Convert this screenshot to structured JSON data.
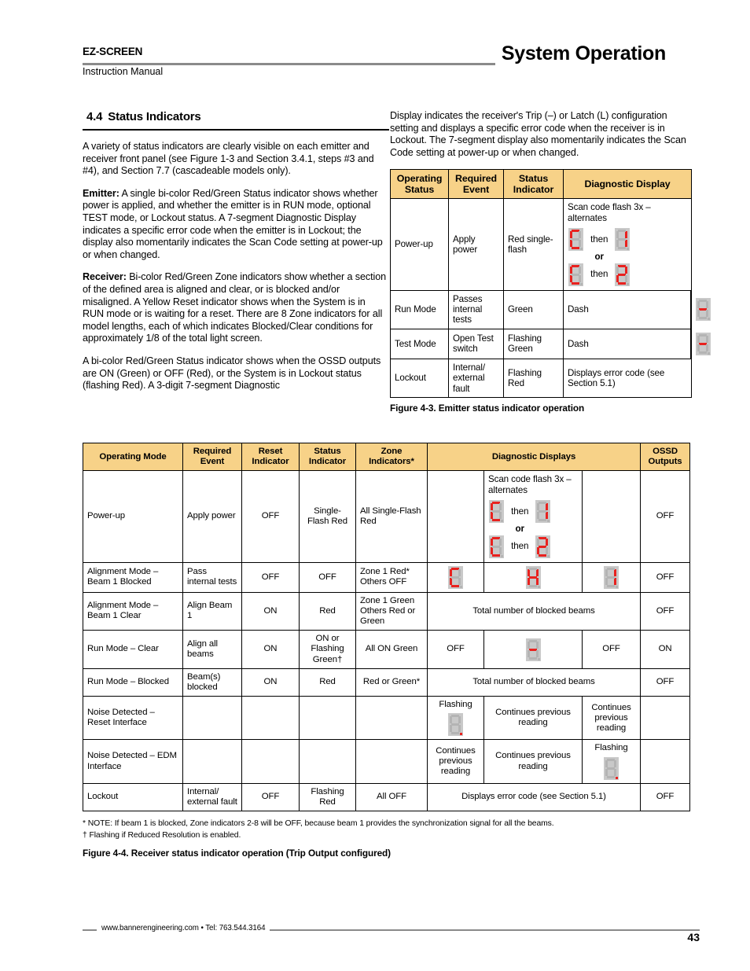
{
  "header": {
    "brand": "EZ-SCREEN",
    "subtitle": "Instruction Manual",
    "title": "System Operation"
  },
  "section": {
    "number": "4.4",
    "title": "Status Indicators"
  },
  "left_column": {
    "p1": "A variety of status indicators are clearly visible on each emitter and receiver front panel (see Figure 1-3 and Section 3.4.1, steps #3 and #4), and Section 7.7 (cascadeable models only).",
    "p2_label": "Emitter:",
    "p2": " A single bi-color Red/Green Status indicator shows whether power is applied, and whether the emitter is in RUN mode, optional TEST mode, or Lockout status. A 7-segment Diagnostic Display indicates a specific error code when the emitter is in Lockout; the display also momentarily indicates the Scan Code setting at power-up or when changed.",
    "p3_label": "Receiver:",
    "p3": " Bi-color Red/Green Zone indicators show whether a section of the defined area is aligned and clear, or is blocked and/or misaligned. A Yellow Reset indicator shows when the System is in RUN mode or is waiting for a reset. There are 8 Zone indicators for all model lengths, each of which indicates Blocked/Clear conditions for approximately 1/8 of the total light screen.",
    "p4": "A bi-color Red/Green Status indicator shows when the OSSD outputs are ON (Green) or OFF (Red), or the System is in Lockout status (flashing Red). A 3-digit 7-segment Diagnostic"
  },
  "right_column": {
    "p1": "Display indicates the receiver's Trip (–) or Latch (L) configuration setting and displays a specific error code when the receiver is in Lockout. The 7-segment display also momentarily indicates the Scan Code setting at power-up or when changed."
  },
  "emitter_table": {
    "headers": [
      "Operating Status",
      "Required Event",
      "Status Indicator",
      "Diagnostic Display"
    ],
    "rows": [
      {
        "status": "Power-up",
        "event": "Apply power",
        "indicator": "Red single-flash",
        "diag_caption": "Scan code flash 3x – alternates",
        "diag_then": "then",
        "diag_or": "or",
        "digits": [
          "C",
          "1",
          "C",
          "2"
        ]
      },
      {
        "status": "Run Mode",
        "event": "Passes internal tests",
        "indicator": "Green",
        "diag_text": "Dash",
        "diag_digit": "dash"
      },
      {
        "status": "Test Mode",
        "event": "Open Test switch",
        "indicator": "Flashing Green",
        "diag_text": "Dash",
        "diag_digit": "dash"
      },
      {
        "status": "Lockout",
        "event": "Internal/ external fault",
        "indicator": "Flashing Red",
        "diag_text": "Displays error code (see Section 5.1)"
      }
    ],
    "caption": "Figure 4-3. Emitter status indicator operation"
  },
  "receiver_table": {
    "headers": [
      "Operating Mode",
      "Required Event",
      "Reset Indicator",
      "Status Indicator",
      "Zone Indicators*",
      "Diagnostic Displays",
      "OSSD Outputs"
    ],
    "rows": [
      {
        "mode": "Power-up",
        "event": "Apply power",
        "reset": "OFF",
        "status": "Single-Flash Red",
        "zone": "All Single-Flash Red",
        "d1": "",
        "d2_caption": "Scan code flash 3x – alternates",
        "d2_then": "then",
        "d2_or": "or",
        "d2_digits": [
          "C",
          "1",
          "C",
          "2"
        ],
        "d3": "",
        "ossd": "OFF"
      },
      {
        "mode": "Alignment Mode – Beam 1 Blocked",
        "event": "Pass internal tests",
        "reset": "OFF",
        "status": "OFF",
        "zone": "Zone 1 Red* Others OFF",
        "d1_digit": "C",
        "d2_digit": "H",
        "d3_digit": "1",
        "ossd": "OFF"
      },
      {
        "mode": "Alignment Mode – Beam 1 Clear",
        "event": "Align Beam 1",
        "reset": "ON",
        "status": "Red",
        "zone": "Zone 1 Green Others Red or Green",
        "d_span": "Total number of blocked beams",
        "ossd": "OFF"
      },
      {
        "mode": "Run Mode – Clear",
        "event": "Align all beams",
        "reset": "ON",
        "status": "ON or Flashing Green†",
        "zone": "All ON Green",
        "d1": "OFF",
        "d2_digit": "dash",
        "d3": "OFF",
        "ossd": "ON"
      },
      {
        "mode": "Run Mode – Blocked",
        "event": "Beam(s) blocked",
        "reset": "ON",
        "status": "Red",
        "zone": "Red or Green*",
        "d_span": "Total number of blocked beams",
        "ossd": "OFF"
      },
      {
        "mode": "Noise Detected – Reset Interface",
        "event": "",
        "reset": "",
        "status": "",
        "zone": "",
        "d1": "Flashing",
        "d1_digit": "blank",
        "d2": "Continues previous reading",
        "d3": "Continues previous reading",
        "ossd": ""
      },
      {
        "mode": "Noise Detected – EDM Interface",
        "event": "",
        "reset": "",
        "status": "",
        "zone": "",
        "d1": "Continues previous reading",
        "d2": "Continues previous reading",
        "d3": "Flashing",
        "d3_digit": "blank",
        "ossd": ""
      },
      {
        "mode": "Lockout",
        "event": "Internal/ external fault",
        "reset": "OFF",
        "status": "Flashing Red",
        "zone": "All OFF",
        "d_span": "Displays error code (see Section 5.1)",
        "ossd": "OFF"
      }
    ],
    "notes": [
      "* NOTE: If beam 1 is blocked, Zone indicators 2-8 will be OFF, because beam 1 provides the synchronization signal for all the beams.",
      "† Flashing if Reduced Resolution is enabled."
    ],
    "caption": "Figure 4-4. Receiver status indicator operation (Trip Output configured)"
  },
  "footer": {
    "text": "www.bannerengineering.com  •  Tel: 763.544.3164",
    "page": "43"
  },
  "colors": {
    "header_fill": "#F7D288",
    "segment_red": "#E8221F",
    "segment_bg": "#C9C9C9",
    "rule_gray": "#8A8A8A"
  }
}
